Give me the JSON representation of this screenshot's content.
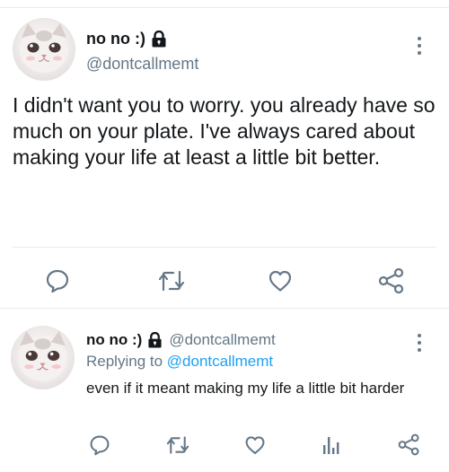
{
  "main_tweet": {
    "name": "no no :)",
    "handle": "@dontcallmemt",
    "text": "I didn't want you to worry. you already have so much on your plate. I've always cared about making your life at least a little bit better.",
    "icons": [
      "lock-icon",
      "more-options-icon",
      "reply-icon",
      "retweet-icon",
      "like-icon",
      "share-icon"
    ]
  },
  "reply_tweet": {
    "name": "no no :)",
    "handle": "@dontcallmemt",
    "replying_label": "Replying to",
    "replying_to": "@dontcallmemt",
    "text": "even if it meant making my life a little bit harder",
    "icons": [
      "lock-icon",
      "more-options-icon",
      "reply-icon",
      "retweet-icon",
      "like-icon",
      "stats-icon",
      "share-icon"
    ]
  },
  "colors": {
    "text": "#14171a",
    "secondary": "#657786",
    "link": "#1da1f2",
    "divider": "#e6ecf0"
  }
}
